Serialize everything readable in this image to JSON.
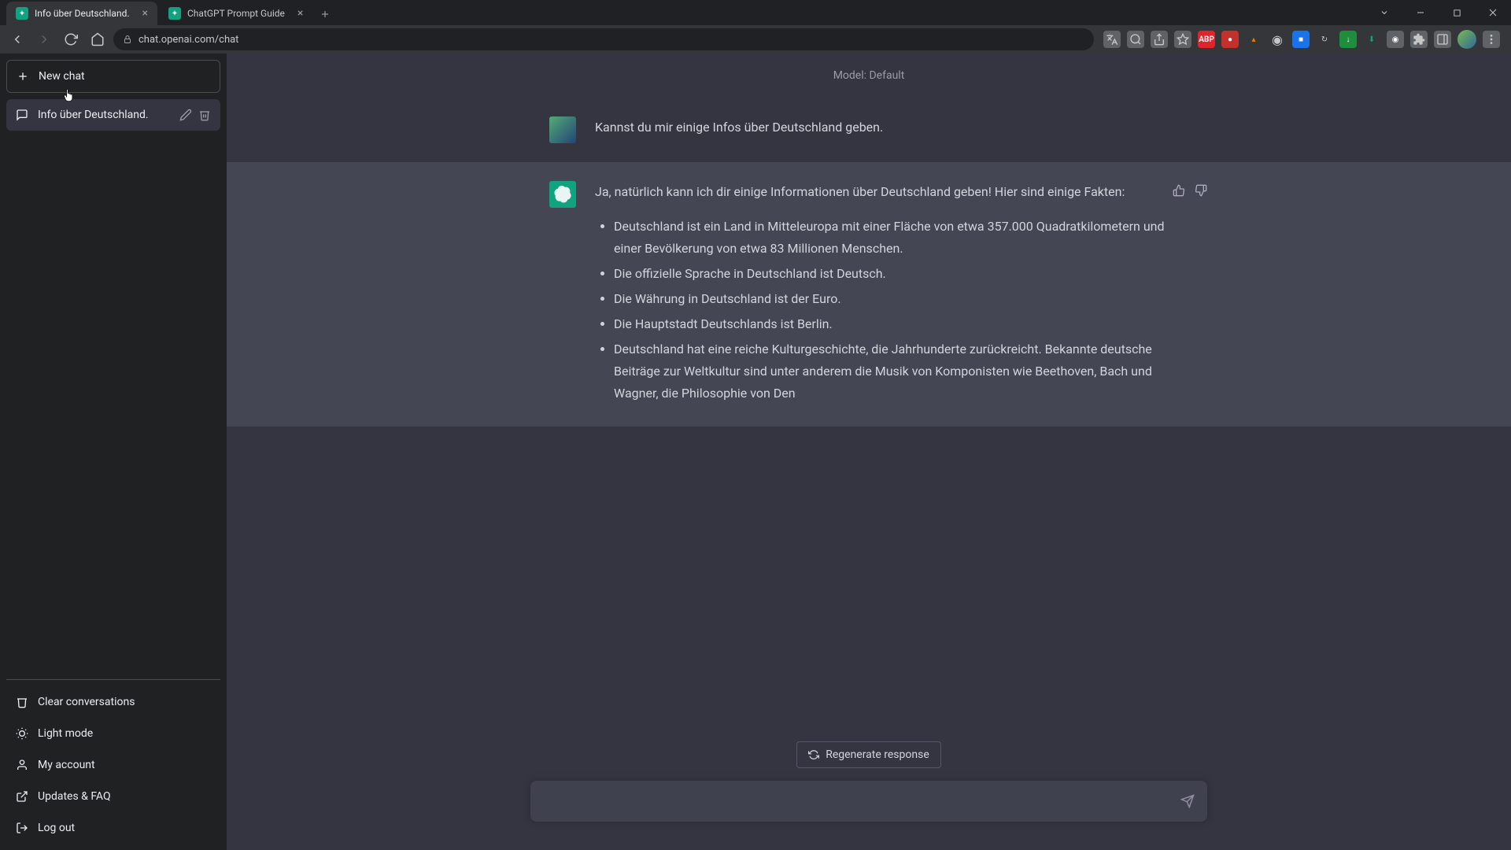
{
  "browser": {
    "tabs": [
      {
        "title": "Info über Deutschland.",
        "active": true
      },
      {
        "title": "ChatGPT Prompt Guide",
        "active": false
      }
    ],
    "url": "chat.openai.com/chat"
  },
  "sidebar": {
    "new_chat": "New chat",
    "chats": [
      {
        "title": "Info über Deutschland."
      }
    ],
    "clear": "Clear conversations",
    "light": "Light mode",
    "account": "My account",
    "updates": "Updates & FAQ",
    "logout": "Log out"
  },
  "main": {
    "model": "Model: Default",
    "user_msg": "Kannst du mir einige Infos über Deutschland geben.",
    "assistant_intro": "Ja, natürlich kann ich dir einige Informationen über Deutschland geben! Hier sind einige Fakten:",
    "facts": [
      "Deutschland ist ein Land in Mitteleuropa mit einer Fläche von etwa 357.000 Quadratkilometern und einer Bevölkerung von etwa 83 Millionen Menschen.",
      "Die offizielle Sprache in Deutschland ist Deutsch.",
      "Die Währung in Deutschland ist der Euro.",
      "Die Hauptstadt Deutschlands ist Berlin.",
      "Deutschland hat eine reiche Kulturgeschichte, die Jahrhunderte zurückreicht. Bekannte deutsche Beiträge zur Weltkultur sind unter anderem die Musik von Komponisten wie Beethoven, Bach und Wagner, die Philosophie von Den"
    ],
    "regenerate": "Regenerate response",
    "input_placeholder": ""
  }
}
